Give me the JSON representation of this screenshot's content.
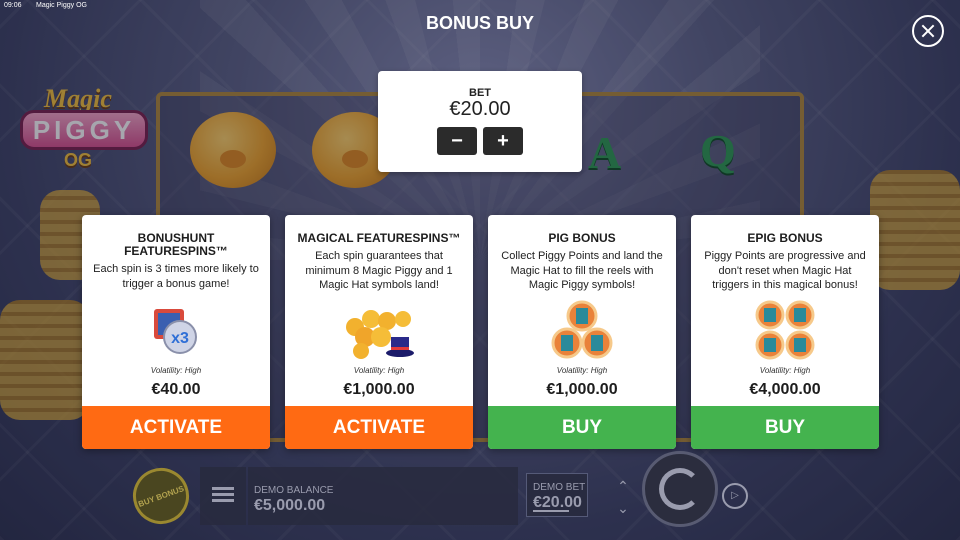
{
  "system": {
    "time": "09:06",
    "window_title": "Magic Piggy OG"
  },
  "header": {
    "title": "BONUS BUY"
  },
  "logo": {
    "line1": "Magic",
    "line2": "PIGGY",
    "line3": "OG"
  },
  "background": {
    "reel_letters": [
      "A",
      "Q"
    ]
  },
  "bet": {
    "label": "BET",
    "value": "€20.00",
    "minus": "−",
    "plus": "+"
  },
  "cards": [
    {
      "title": "BONUSHUNT FEATURESPINS™",
      "description": "Each spin is 3 times more likely to trigger a bonus game!",
      "icon": "x3-multiplier-icon",
      "icon_text": "x3",
      "volatility": "Volatility: High",
      "price": "€40.00",
      "button": "ACTIVATE",
      "button_color": "#ff6a13"
    },
    {
      "title": "MAGICAL FEATURESPINS™",
      "description": "Each spin guarantees that minimum 8 Magic Piggy and 1 Magic Hat symbols land!",
      "icon": "piggies-and-hat-icon",
      "volatility": "Volatility: High",
      "price": "€1,000.00",
      "button": "ACTIVATE",
      "button_color": "#ff6a13"
    },
    {
      "title": "PIG BONUS",
      "description": "Collect Piggy Points and land the Magic Hat to fill the reels with Magic Piggy symbols!",
      "icon": "three-piggy-coins-icon",
      "volatility": "Volatility: High",
      "price": "€1,000.00",
      "button": "BUY",
      "button_color": "#44b34e"
    },
    {
      "title": "EPIG BONUS",
      "description": "Piggy Points are progressive and don't reset when Magic Hat triggers in this magical bonus!",
      "icon": "four-piggy-coins-icon",
      "volatility": "Volatility: High",
      "price": "€4,000.00",
      "button": "BUY",
      "button_color": "#44b34e"
    }
  ],
  "bottom_bar": {
    "buy_bonus": "BUY BONUS",
    "balance_label": "DEMO BALANCE",
    "balance_value": "€5,000.00",
    "demo_bet_label": "DEMO BET",
    "demo_bet_value": "€20.00",
    "arrow_up": "⌃",
    "arrow_down": "⌄",
    "autoplay_icon": "▷"
  }
}
